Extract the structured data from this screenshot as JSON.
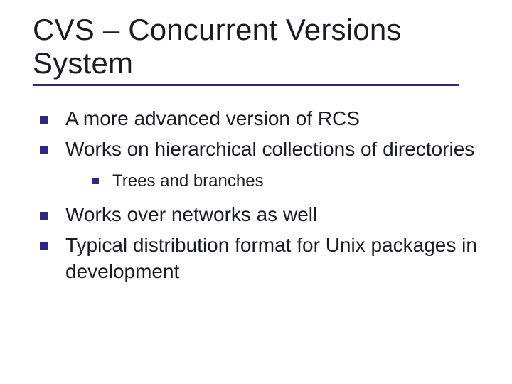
{
  "title": "CVS – Concurrent Versions System",
  "bullets": {
    "b0": "A more advanced version of RCS",
    "b1": "Works on hierarchical collections of directories",
    "b1_sub0": "Trees and branches",
    "b2": "Works over networks as well",
    "b3": "Typical distribution format for Unix packages in development"
  }
}
